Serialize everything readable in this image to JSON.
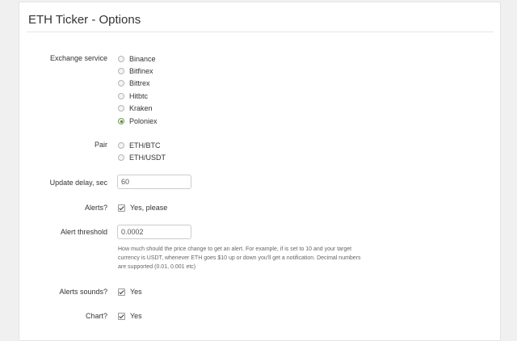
{
  "page": {
    "title": "ETH Ticker - Options"
  },
  "exchange": {
    "label": "Exchange service",
    "options": [
      {
        "label": "Binance",
        "checked": false
      },
      {
        "label": "Bitfinex",
        "checked": false
      },
      {
        "label": "Bittrex",
        "checked": false
      },
      {
        "label": "Hitbtc",
        "checked": false
      },
      {
        "label": "Kraken",
        "checked": false
      },
      {
        "label": "Poloniex",
        "checked": true
      }
    ]
  },
  "pair": {
    "label": "Pair",
    "options": [
      {
        "label": "ETH/BTC",
        "checked": false
      },
      {
        "label": "ETH/USDT",
        "checked": false
      }
    ]
  },
  "update_delay": {
    "label": "Update delay, sec",
    "value": "60"
  },
  "alerts": {
    "label": "Alerts?",
    "checkbox_label": "Yes, please",
    "checked": true
  },
  "alert_threshold": {
    "label": "Alert threshold",
    "value": "0.0002",
    "help": "How much should the price change to get an alert. For example, if is set to 10 and your target currency is USDT, whenever ETH goes $10 up or down you'll get a notification. Decimal numbers are supported (0.01, 0.001 etc)"
  },
  "alerts_sounds": {
    "label": "Alerts sounds?",
    "checkbox_label": "Yes",
    "checked": true
  },
  "chart": {
    "label": "Chart?",
    "checkbox_label": "Yes",
    "checked": true
  }
}
